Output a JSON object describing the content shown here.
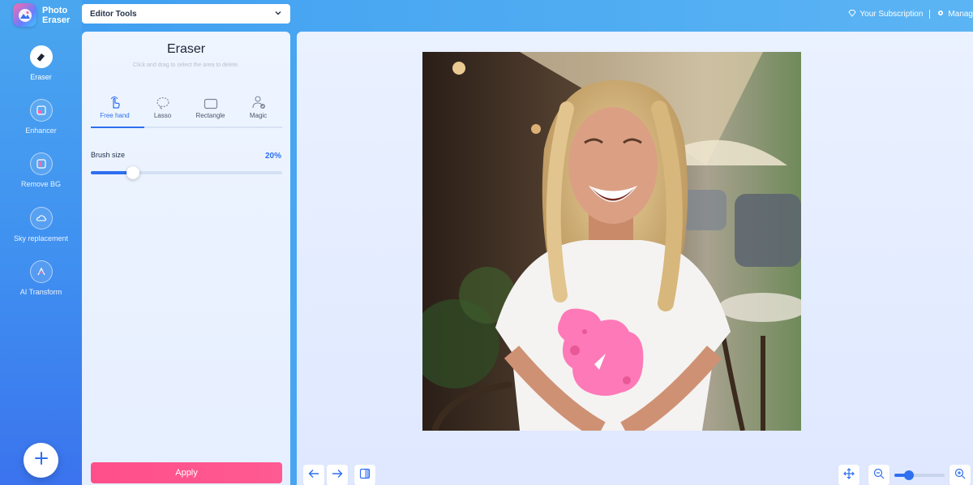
{
  "app": {
    "name_line1": "Photo",
    "name_line2": "Eraser"
  },
  "header": {
    "tools_select": "Editor Tools",
    "subscription": "Your Subscription",
    "manage": "Manag"
  },
  "sidebar": {
    "items": [
      {
        "label": "Eraser",
        "icon": "eraser-icon"
      },
      {
        "label": "Enhancer",
        "icon": "enhancer-icon"
      },
      {
        "label": "Remove BG",
        "icon": "remove-bg-icon"
      },
      {
        "label": "Sky replacement",
        "icon": "cloud-icon"
      },
      {
        "label": "AI Transform",
        "icon": "ai-transform-icon"
      }
    ],
    "active": "Eraser"
  },
  "panel": {
    "title": "Eraser",
    "hint": "Click and drag to select the area to delete.",
    "modes": [
      "Free hand",
      "Lasso",
      "Rectangle",
      "Magic"
    ],
    "active_mode": "Free hand",
    "brush_label": "Brush size",
    "brush_value": "20%",
    "brush_level": 0.22,
    "apply_label": "Apply"
  },
  "canvas": {
    "zoom_level": 0.3
  },
  "colors": {
    "accent": "#2f6ff0",
    "apply": "#ff5090",
    "selection": "#ff6fb4"
  }
}
